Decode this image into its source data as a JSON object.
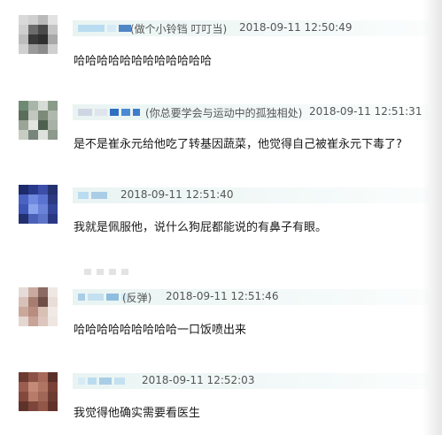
{
  "comments": [
    {
      "nickname": "(做个小铃铛 叮叮当)",
      "time": "2018-09-11 12:50:49",
      "text": "哈哈哈哈哈哈哈哈哈哈哈哈",
      "avatar_colors": [
        "#d9d9d9",
        "#cfcfcf",
        "#b9b9b9",
        "#e2e2e2",
        "#cfcfcf",
        "#6c6c6c",
        "#4a4a4a",
        "#c4c4c4",
        "#bdbdbd",
        "#3a3a3a",
        "#2f2f2f",
        "#a8a8a8",
        "#d0d0d0",
        "#9a9a9a",
        "#8c8c8c",
        "#cfcfcf"
      ]
    },
    {
      "nickname": "(你总要学会与运动中的孤独相处)",
      "time": "2018-09-11 12:51:31",
      "text": "是不是崔永元给他吃了转基因蔬菜，他觉得自己被崔永元下毒了?",
      "avatar_colors": [
        "#6f8a74",
        "#a7b6a9",
        "#d7dcd6",
        "#8a9b88",
        "#5b6e5c",
        "#c2c7bf",
        "#7c8a7a",
        "#b0b8ad",
        "#9aa596",
        "#e3e6e0",
        "#4e5f50",
        "#a9b1a6",
        "#c8cdc4",
        "#77857a",
        "#dfe2dc",
        "#8d9a8b"
      ]
    },
    {
      "nickname": "",
      "time": "2018-09-11 12:51:40",
      "text": "我就是佩服他，说什么狗屁都能说的有鼻子有眼。",
      "avatar_colors": [
        "#1d2a6b",
        "#2a3a8a",
        "#3b4ea8",
        "#243270",
        "#4a63c2",
        "#6f88e0",
        "#5a72d0",
        "#2b3a82",
        "#3d55b4",
        "#8aa3ec",
        "#6a82d8",
        "#34469a",
        "#23306e",
        "#4b60b8",
        "#5d74c8",
        "#2a3884"
      ]
    },
    {
      "nickname": "(反弹)",
      "time": "2018-09-11 12:51:46",
      "text": "哈哈哈哈哈哈哈哈哈一口饭喷出来",
      "avatar_colors": [
        "#e6dcd7",
        "#c9aaa0",
        "#8a6a62",
        "#efe7e3",
        "#d8c1b8",
        "#a67d70",
        "#6e4e47",
        "#e9ddd8",
        "#caa89b",
        "#b88d80",
        "#d9c0b5",
        "#f1e9e5",
        "#e4d6d0",
        "#c7a497",
        "#dcc6bd",
        "#efe6e2"
      ]
    },
    {
      "nickname": "",
      "time": "2018-09-11 12:52:03",
      "text": "我觉得他确实需要看医生",
      "avatar_colors": [
        "#6b3a30",
        "#8c5146",
        "#a8695a",
        "#5a2f27",
        "#9a5d4f",
        "#c48a78",
        "#b07563",
        "#7a4236",
        "#84493d",
        "#b77c69",
        "#a06656",
        "#6e3b31",
        "#5e332b",
        "#7d463a",
        "#935748",
        "#613229"
      ]
    }
  ],
  "colors": {
    "header_bar": "#e9f4f2",
    "name_blur": "#a9cde6",
    "name_blur_dark": "#4f86c6",
    "meta_text": "#555555"
  }
}
